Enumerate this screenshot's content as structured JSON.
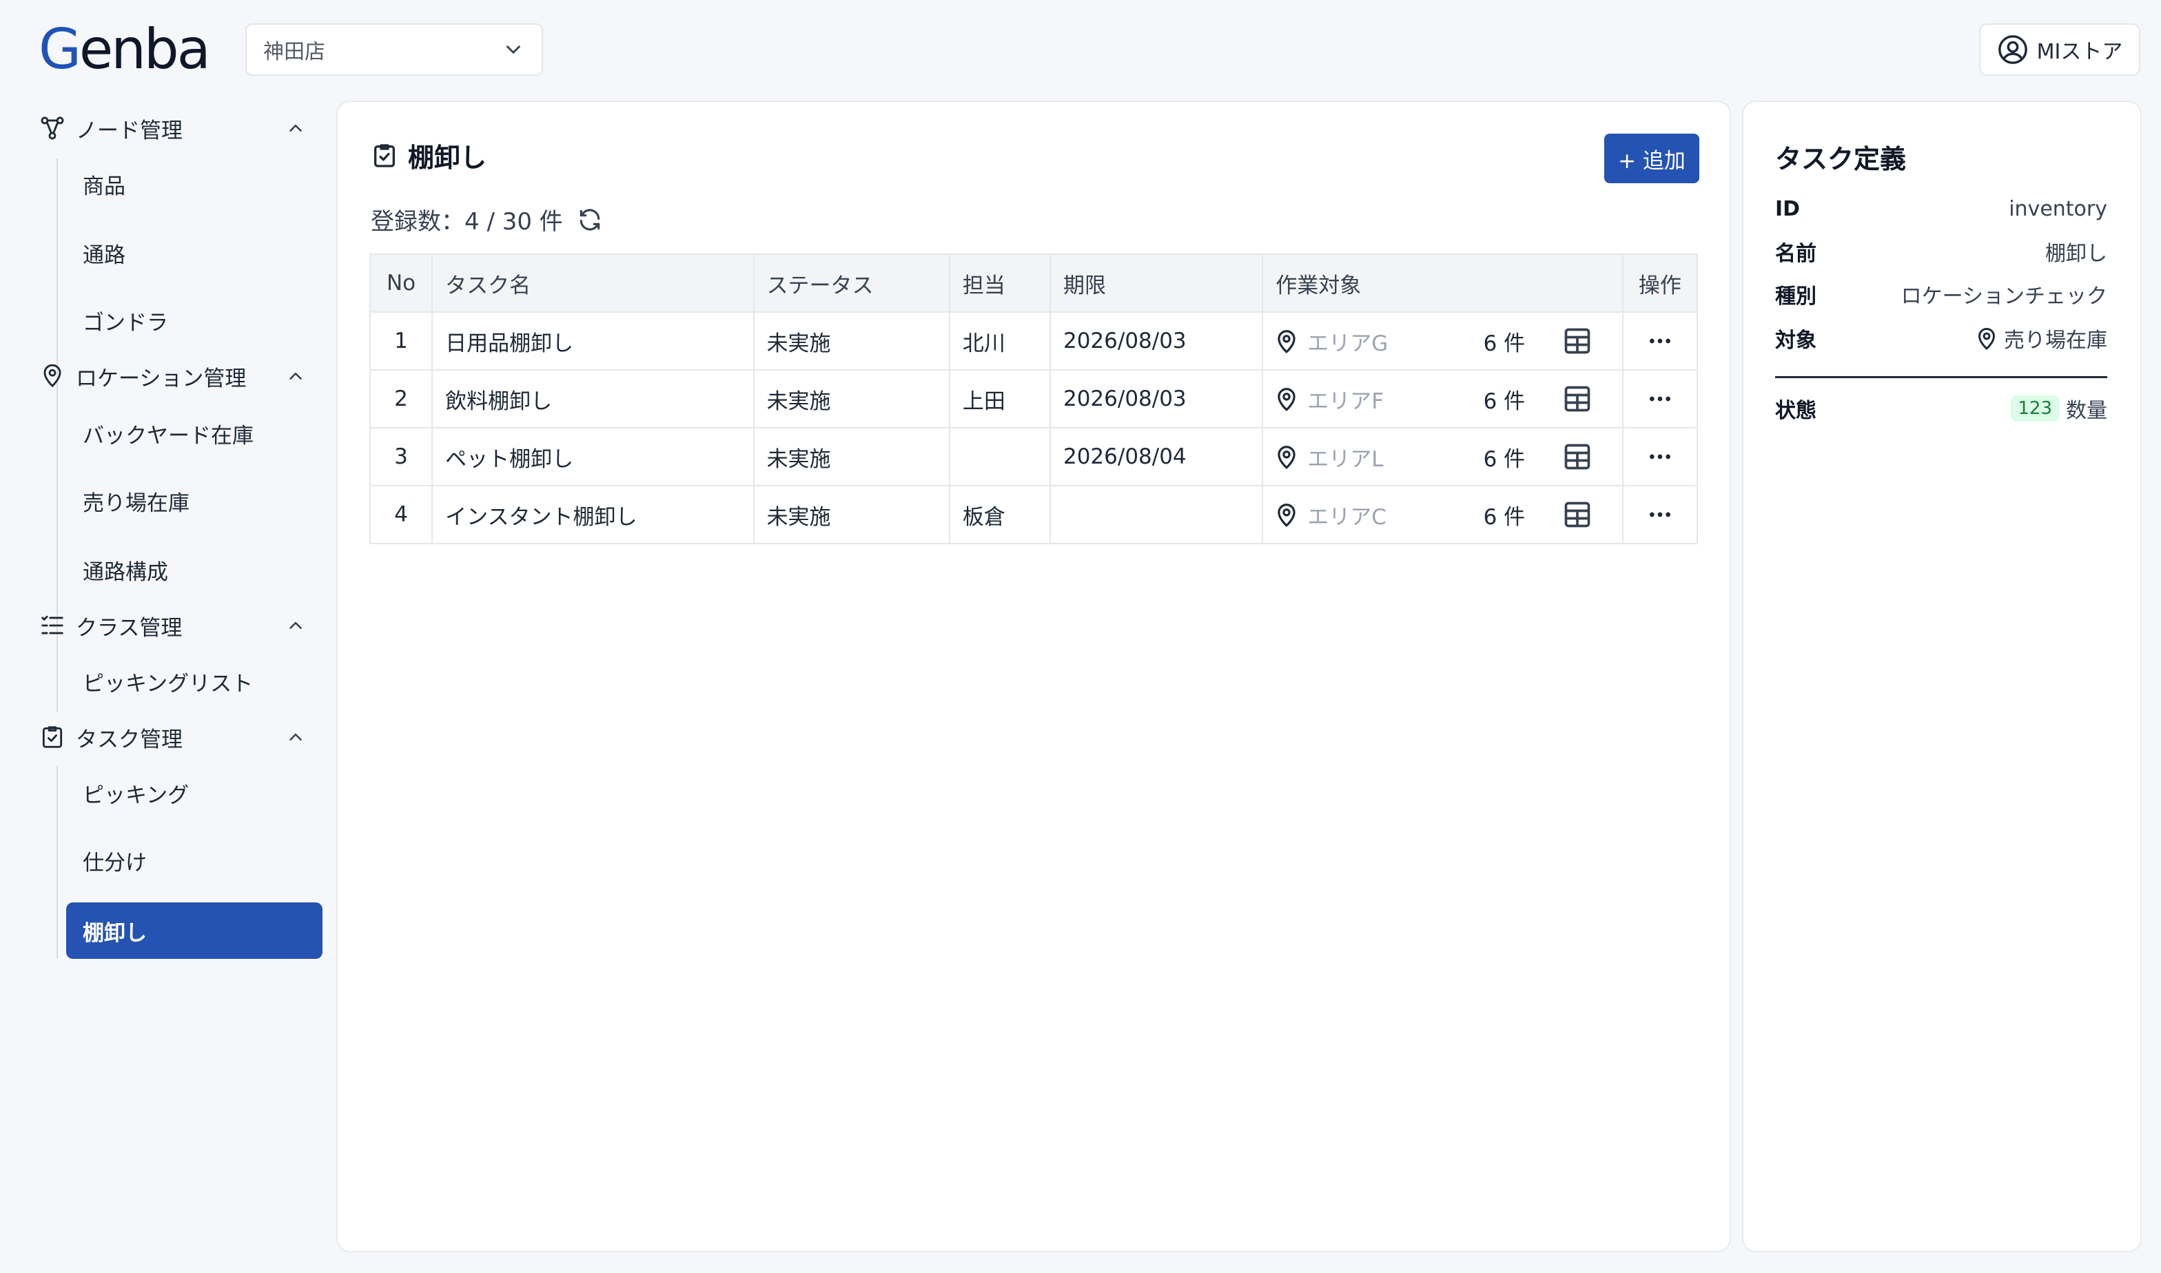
{
  "header": {
    "logo": "Genba",
    "store": "神田店",
    "user": "MIストア"
  },
  "sidebar": {
    "sections": [
      {
        "label": "ノード管理",
        "icon": "node-icon",
        "items": [
          "商品",
          "通路",
          "ゴンドラ"
        ]
      },
      {
        "label": "ロケーション管理",
        "icon": "location-pin-icon",
        "items": [
          "バックヤード在庫",
          "売り場在庫",
          "通路構成"
        ]
      },
      {
        "label": "クラス管理",
        "icon": "list-check-icon",
        "items": [
          "ピッキングリスト"
        ]
      },
      {
        "label": "タスク管理",
        "icon": "clipboard-check-icon",
        "items": [
          "ピッキング",
          "仕分け",
          "棚卸し"
        ]
      }
    ],
    "active_item": "棚卸し"
  },
  "main": {
    "title": "棚卸し",
    "add_label": "+ 追加",
    "count_label": "登録数：4 / 30 件",
    "columns": [
      "No",
      "タスク名",
      "ステータス",
      "担当",
      "期限",
      "作業対象",
      "操作"
    ],
    "rows": [
      {
        "no": "1",
        "name": "日用品棚卸し",
        "status": "未実施",
        "assignee": "北川",
        "due": "2026/08/03",
        "area": "エリアG",
        "count": "6 件"
      },
      {
        "no": "2",
        "name": "飲料棚卸し",
        "status": "未実施",
        "assignee": "上田",
        "due": "2026/08/03",
        "area": "エリアF",
        "count": "6 件"
      },
      {
        "no": "3",
        "name": "ペット棚卸し",
        "status": "未実施",
        "assignee": "",
        "due": "2026/08/04",
        "area": "エリアL",
        "count": "6 件"
      },
      {
        "no": "4",
        "name": "インスタント棚卸し",
        "status": "未実施",
        "assignee": "板倉",
        "due": "",
        "area": "エリアC",
        "count": "6 件"
      }
    ]
  },
  "detail": {
    "title": "タスク定義",
    "fields": [
      {
        "key": "ID",
        "value": "inventory"
      },
      {
        "key": "名前",
        "value": "棚卸し"
      },
      {
        "key": "種別",
        "value": "ロケーションチェック"
      },
      {
        "key": "対象",
        "value": "売り場在庫"
      }
    ],
    "state_key": "状態",
    "state_badge": "123",
    "state_value": "数量"
  },
  "colors": {
    "accent": "#2553b3",
    "background": "#f5f7fa",
    "badge_bg": "#dcfce7",
    "badge_fg": "#15803d"
  }
}
